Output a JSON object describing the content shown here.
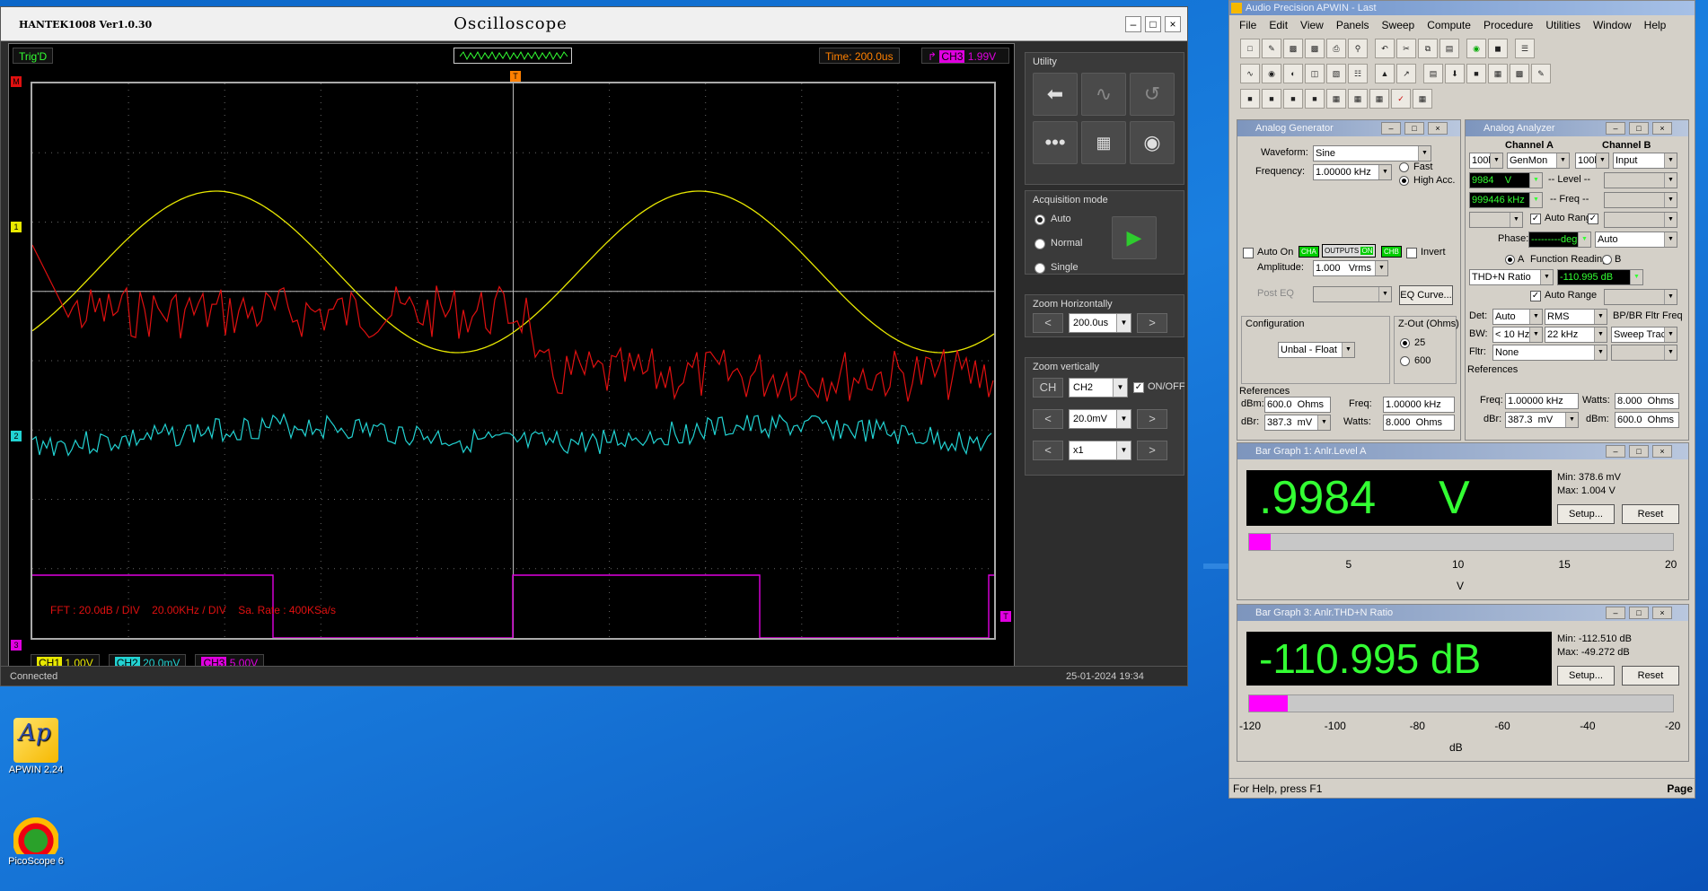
{
  "desktop": {
    "icons": [
      {
        "label": "APWIN 2.24"
      },
      {
        "label": "PicoScope 6"
      }
    ]
  },
  "scope": {
    "app_name": "HANTEK1008 Ver1.0.30",
    "window_title": "Oscilloscope",
    "trig_status": "Trig'D",
    "time_base": "Time: 200.0us",
    "trigger_channel": "CH3",
    "trigger_level": "1.99V",
    "fft_info": {
      "fft": "FFT : 20.0dB / DIV",
      "freq": "20.00KHz / DIV",
      "rate": "Sa. Rate : 400KSa/s"
    },
    "channels": [
      {
        "name": "CH1",
        "scale": "1.00V",
        "color": "#e8e800"
      },
      {
        "name": "CH2",
        "scale": "20.0mV",
        "color": "#22d3d3"
      },
      {
        "name": "CH3",
        "scale": "5.00V",
        "color": "#e000e0"
      }
    ],
    "fft_color": "#e01010",
    "markers": [
      "M",
      "1",
      "2",
      "3",
      "T"
    ],
    "utility": {
      "title": "Utility",
      "icons": [
        "back-arrow-icon",
        "waveform-icon",
        "undo-icon",
        "more-icon",
        "qr-code-icon",
        "camera-icon"
      ]
    },
    "acquisition": {
      "title": "Acquisition mode",
      "modes": [
        "Auto",
        "Normal",
        "Single"
      ],
      "selected": "Auto"
    },
    "zoom_h": {
      "title": "Zoom Horizontally",
      "value": "200.0us"
    },
    "zoom_v": {
      "title": "Zoom vertically",
      "ch_label": "CH",
      "channel": "CH2",
      "onoff_label": "ON/OFF",
      "volts": "20.0mV",
      "probe": "x1"
    },
    "status": {
      "left": "Connected",
      "right": "25-01-2024  19:34"
    }
  },
  "apwin": {
    "title": "Audio Precision APWIN - Last",
    "menu": [
      "File",
      "Edit",
      "View",
      "Panels",
      "Sweep",
      "Compute",
      "Procedure",
      "Utilities",
      "Window",
      "Help"
    ],
    "generator": {
      "title": "Analog Generator",
      "waveform_label": "Waveform:",
      "waveform": "Sine",
      "frequency_label": "Frequency:",
      "frequency": "1.00000 kHz",
      "fast": "Fast",
      "high_acc": "High Acc.",
      "auto_on": "Auto On",
      "cha": "CHA",
      "outputs": "OUTPUTS",
      "on": "ON",
      "chb": "CHB",
      "invert": "Invert",
      "amplitude_label": "Amplitude:",
      "amplitude": "1.000",
      "amplitude_unit": "Vrms",
      "post_eq": "Post EQ",
      "eq_curve": "EQ Curve...",
      "config_label": "Configuration",
      "config": "Unbal - Float",
      "zout_label": "Z-Out (Ohms)",
      "zout_25": "25",
      "zout_600": "600",
      "references": "References",
      "dbm_label": "dBm:",
      "dbm": "600.0",
      "dbm_unit": "Ohms",
      "freq_label": "Freq:",
      "freq_ref": "1.00000 kHz",
      "dbr_label": "dBr:",
      "dbr": "387.3",
      "dbr_unit": "mV",
      "watts_label": "Watts:",
      "watts": "8.000",
      "watts_unit": "Ohms"
    },
    "analyzer": {
      "title": "Analog Analyzer",
      "channel_a": "Channel A",
      "channel_b": "Channel B",
      "a_range": "100l",
      "a_input": "GenMon",
      "b_range": "100l",
      "b_input": "Input",
      "level": "9984",
      "level_unit": "V",
      "level_label": "-- Level --",
      "freq_val": "999446 kHz",
      "freq_label": "-- Freq --",
      "auto_range": "Auto Range",
      "phase_label": "Phase:",
      "phase_unit": "deg",
      "phase_mode": "Auto",
      "a_label": "A",
      "function_reading": "Function Reading",
      "b_label": "B",
      "function": "THD+N Ratio",
      "function_value": "-110.995 dB",
      "auto_range2": "Auto Range",
      "det_label": "Det:",
      "det": "Auto",
      "det_mode": "RMS",
      "bpbr": "BP/BR Fltr Freq",
      "bw_label": "BW:",
      "bw_low": "< 10 Hz",
      "bw_high": "22 kHz",
      "sweep_track": "Sweep Track",
      "fltr_label": "Fltr:",
      "fltr": "None",
      "references": "References",
      "freq_ref_label": "Freq:",
      "freq_ref": "1.00000 kHz",
      "watts_label": "Watts:",
      "watts": "8.000",
      "watts_unit": "Ohms",
      "dbr_label": "dBr:",
      "dbr": "387.3",
      "dbr_unit": "mV",
      "dbm_label": "dBm:",
      "dbm": "600.0",
      "dbm_unit": "Ohms"
    },
    "bargraph1": {
      "title": "Bar Graph 1: Anlr.Level A",
      "value": ".9984",
      "unit": "V",
      "min": "Min: 378.6  mV",
      "max": "Max: 1.004  V",
      "setup": "Setup...",
      "reset": "Reset",
      "scale": [
        "5",
        "10",
        "15",
        "20"
      ],
      "axis": "V",
      "range": [
        0,
        20
      ],
      "reading": 0.9984
    },
    "bargraph3": {
      "title": "Bar Graph 3: Anlr.THD+N Ratio",
      "value": "-110.995 dB",
      "min": "Min: -112.510 dB",
      "max": "Max: -49.272  dB",
      "setup": "Setup...",
      "reset": "Reset",
      "scale": [
        "-120",
        "-100",
        "-80",
        "-60",
        "-40",
        "-20"
      ],
      "axis": "dB",
      "range": [
        -120,
        -20
      ],
      "reading": -110.995
    },
    "status": "For Help, press F1",
    "page": "Page"
  }
}
